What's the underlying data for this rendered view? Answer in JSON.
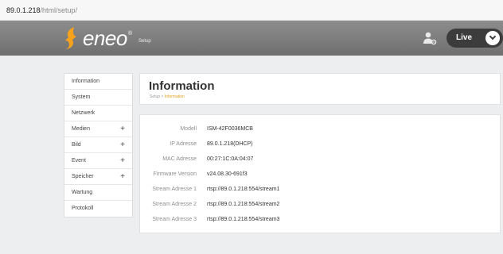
{
  "address_bar": {
    "host": "89.0.1.218",
    "path": "/html/setup/"
  },
  "header": {
    "logo_text": "eneo",
    "logo_sup": "®",
    "logo_subtitle": "Setup",
    "live_label": "Live",
    "colors": {
      "accent": "#f6a21c",
      "header": "#7f7f7f"
    }
  },
  "sidebar": {
    "items": [
      {
        "label": "Information",
        "expandable": false
      },
      {
        "label": "System",
        "expandable": false
      },
      {
        "label": "Netzwerk",
        "expandable": false
      },
      {
        "label": "Medien",
        "expandable": true
      },
      {
        "label": "Bild",
        "expandable": true
      },
      {
        "label": "Event",
        "expandable": true
      },
      {
        "label": "Speicher",
        "expandable": true
      },
      {
        "label": "Wartung",
        "expandable": false
      },
      {
        "label": "Protokoll",
        "expandable": false
      }
    ],
    "expand_symbol": "+"
  },
  "main": {
    "title": "Information",
    "breadcrumb": {
      "root": "Setup",
      "separator": ">",
      "current": "Information"
    },
    "rows": [
      {
        "label": "Modell",
        "value": "ISM-42F0036MCB"
      },
      {
        "label": "IP Adresse",
        "value": "89.0.1.218(DHCP)"
      },
      {
        "label": "MAC Adresse",
        "value": "00:27:1C:0A:04:07"
      },
      {
        "label": "Firmware Version",
        "value": "v24.08.30-691f3"
      },
      {
        "label": "Stream Adresse 1",
        "value": "rtsp://89.0.1.218:554/stream1"
      },
      {
        "label": "Stream Adresse 2",
        "value": "rtsp://89.0.1.218:554/stream2"
      },
      {
        "label": "Stream Adresse 3",
        "value": "rtsp://89.0.1.218:554/stream3"
      }
    ]
  }
}
